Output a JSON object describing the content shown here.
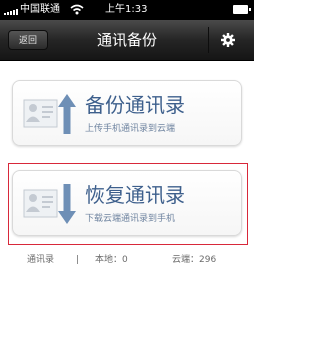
{
  "status_bar": {
    "carrier": "中国联通",
    "time": "上午1:33"
  },
  "nav": {
    "back_label": "返回",
    "title": "通讯备份"
  },
  "actions": {
    "backup": {
      "title": "备份通讯录",
      "subtitle": "上传手机通讯录到云端"
    },
    "restore": {
      "title": "恢复通讯录",
      "subtitle": "下载云端通讯录到手机"
    }
  },
  "stats": {
    "label": "通讯录",
    "separator": "|",
    "local": "本地：0",
    "cloud": "云端：296"
  },
  "colors": {
    "nav_background": "#252525",
    "card_title": "#3d5f8c",
    "card_subtitle": "#6f84a0",
    "arrow": "#6e8fb6",
    "highlight": "#d8283a"
  },
  "icons": {
    "backup": "contact-card-up-arrow-icon",
    "restore": "contact-card-down-arrow-icon",
    "settings": "gear-icon"
  }
}
